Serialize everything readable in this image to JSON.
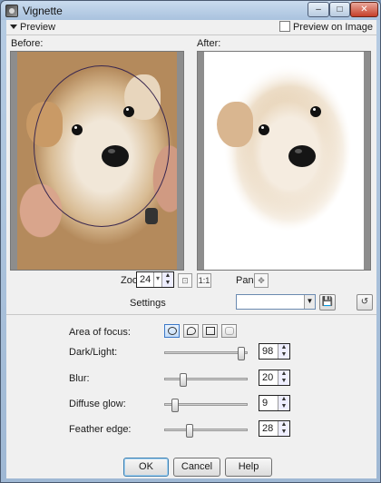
{
  "window": {
    "title": "Vignette"
  },
  "preview": {
    "toggle_label": "Preview",
    "preview_on_image_label": "Preview on Image",
    "before_label": "Before:",
    "after_label": "After:"
  },
  "zoom": {
    "label": "Zoom:",
    "value": "24"
  },
  "pan": {
    "label": "Pan:"
  },
  "settings": {
    "label": "Settings",
    "preset_value": ""
  },
  "controls": {
    "area_of_focus_label": "Area of focus:",
    "dark_light": {
      "label": "Dark/Light:",
      "value": "98",
      "level": 0.98
    },
    "blur": {
      "label": "Blur:",
      "value": "20",
      "level": 0.2
    },
    "diffuse_glow": {
      "label": "Diffuse glow:",
      "value": "9",
      "level": 0.09
    },
    "feather_edge": {
      "label": "Feather edge:",
      "value": "28",
      "level": 0.28
    }
  },
  "buttons": {
    "ok": "OK",
    "cancel": "Cancel",
    "help": "Help"
  },
  "icons": {
    "app": "vignette-app-icon",
    "zoom_fit": "zoom-fit-icon",
    "zoom_actual": "actual-size-icon",
    "pan": "pan-icon",
    "save_preset": "save-icon",
    "reset": "reset-icon"
  }
}
